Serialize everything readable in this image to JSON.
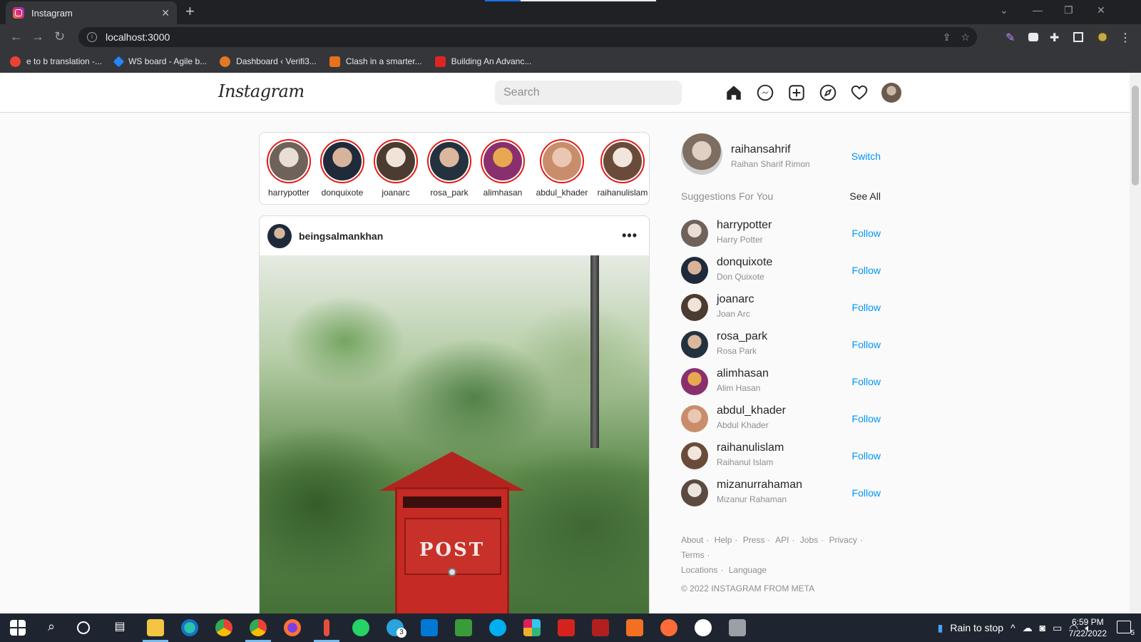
{
  "browser": {
    "tab_title": "Instagram",
    "tab_close": "✕",
    "new_tab": "+",
    "url": "localhost:3000",
    "bookmarks": [
      {
        "label": "e to b translation -...",
        "color": "#ea4335"
      },
      {
        "label": "WS board - Agile b...",
        "color": "#2684ff"
      },
      {
        "label": "Dashboard ‹ Verifi3...",
        "color": "#e07b24"
      },
      {
        "label": "Clash in a smarter...",
        "color": "#e8711c"
      },
      {
        "label": "Building An Advanc...",
        "color": "#e02424"
      }
    ]
  },
  "header": {
    "logo": "Instagram",
    "search_placeholder": "Search"
  },
  "stories": [
    {
      "username": "harrypotter",
      "colors": [
        "#e9ded6",
        "#6f625a"
      ]
    },
    {
      "username": "donquixote",
      "colors": [
        "#d6b39a",
        "#1f2a3a"
      ]
    },
    {
      "username": "joanarc",
      "colors": [
        "#f0e4da",
        "#4c3b30"
      ]
    },
    {
      "username": "rosa_park",
      "colors": [
        "#d9b89e",
        "#24313f"
      ]
    },
    {
      "username": "alimhasan",
      "colors": [
        "#e7a84f",
        "#8a2f6e"
      ]
    },
    {
      "username": "abdul_khader",
      "colors": [
        "#e9c7b3",
        "#c98d6c"
      ]
    },
    {
      "username": "raihanulislam",
      "colors": [
        "#f2e6dc",
        "#6a4b3a"
      ]
    }
  ],
  "post": {
    "username": "beingsalmankhan",
    "more": "•••",
    "image_text": "POST"
  },
  "sidebar": {
    "me": {
      "username": "raihansahrif",
      "name": "Raihan Sharif Rimon",
      "switch": "Switch"
    },
    "suggestions_title": "Suggestions For You",
    "see_all": "See All",
    "follow_label": "Follow",
    "suggestions": [
      {
        "username": "harrypotter",
        "name": "Harry Potter",
        "colors": [
          "#e9ded6",
          "#6f625a"
        ]
      },
      {
        "username": "donquixote",
        "name": "Don Quixote",
        "colors": [
          "#d6b39a",
          "#1f2a3a"
        ]
      },
      {
        "username": "joanarc",
        "name": "Joan Arc",
        "colors": [
          "#f0e4da",
          "#4c3b30"
        ]
      },
      {
        "username": "rosa_park",
        "name": "Rosa Park",
        "colors": [
          "#d9b89e",
          "#24313f"
        ]
      },
      {
        "username": "alimhasan",
        "name": "Alim Hasan",
        "colors": [
          "#e7a84f",
          "#8a2f6e"
        ]
      },
      {
        "username": "abdul_khader",
        "name": "Abdul Khader",
        "colors": [
          "#e9c7b3",
          "#c98d6c"
        ]
      },
      {
        "username": "raihanulislam",
        "name": "Raihanul Islam",
        "colors": [
          "#f2e6dc",
          "#6a4b3a"
        ]
      },
      {
        "username": "mizanurrahaman",
        "name": "Mizanur Rahaman",
        "colors": [
          "#ece4de",
          "#5b4a40"
        ]
      }
    ],
    "footer_links": [
      "About",
      "Help",
      "Press",
      "API",
      "Jobs",
      "Privacy",
      "Terms",
      "Locations",
      "Language"
    ],
    "copyright": "© 2022 INSTAGRAM FROM META"
  },
  "taskbar": {
    "weather": "Rain to stop",
    "time": "6:59 PM",
    "date": "7/22/2022",
    "telegram_badge": "3",
    "notif_count": "5"
  },
  "colors": {
    "accent": "#0095f6",
    "story_ring": "#e41b17"
  }
}
